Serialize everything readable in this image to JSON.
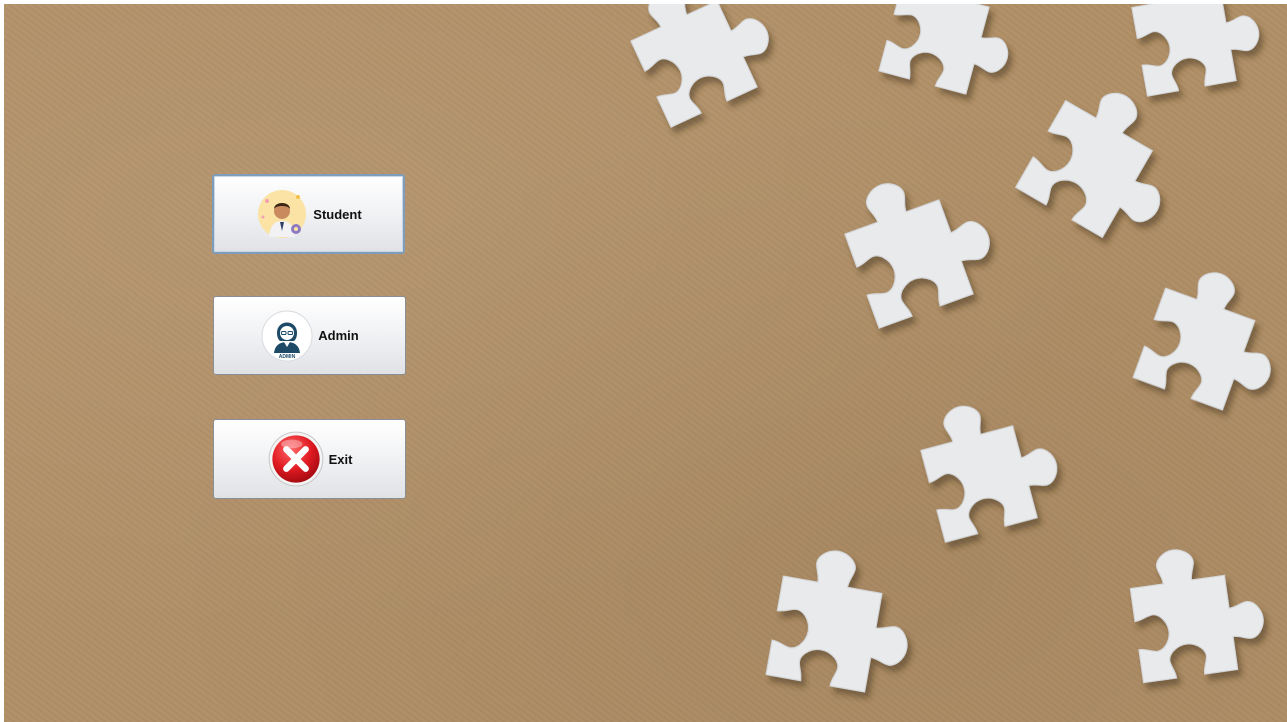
{
  "menu": {
    "student_label": "Student",
    "admin_label": "Admin",
    "exit_label": "Exit",
    "admin_badge": "ADMIN"
  },
  "icons": {
    "student": "student-avatar-icon",
    "admin": "admin-avatar-icon",
    "exit": "red-x-icon",
    "background": "puzzle-pieces"
  },
  "colors": {
    "background": "#b08f66",
    "puzzle_piece": "#e9eaec",
    "exit_red": "#d8141c",
    "admin_navy": "#1d4a66"
  }
}
